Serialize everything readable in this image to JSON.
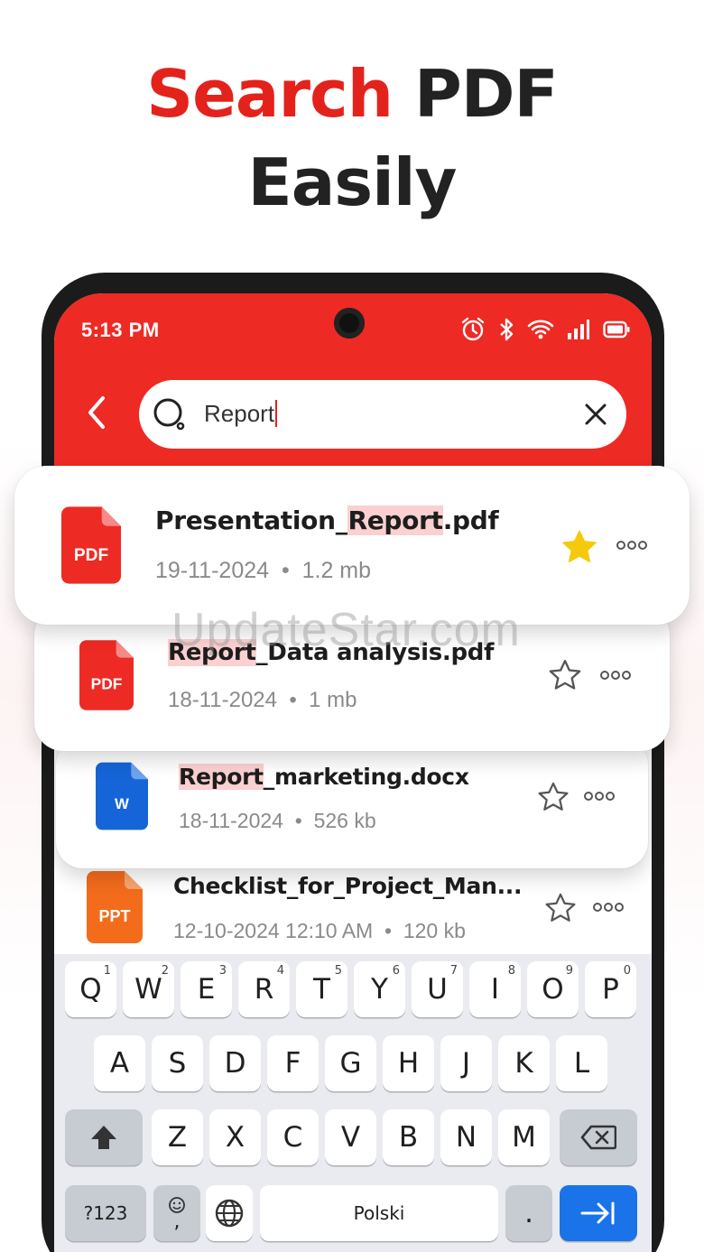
{
  "headline": {
    "line1_accent": "Search",
    "line1_rest": " PDF",
    "line2": "Easily"
  },
  "status_bar": {
    "time": "5:13 PM"
  },
  "search": {
    "query": "Report"
  },
  "files": [
    {
      "name_pre": "Presentation_",
      "name_hl": "Report",
      "name_post": ".pdf",
      "date": "19-11-2024",
      "size": "1.2 mb",
      "type_label": "PDF",
      "starred": true
    },
    {
      "name_pre": "",
      "name_hl": "Report",
      "name_post": "_Data analysis.pdf",
      "date": "18-11-2024",
      "size": "1 mb",
      "type_label": "PDF",
      "starred": false
    },
    {
      "name_pre": "",
      "name_hl": "Report",
      "name_post": "_marketing.docx",
      "date": "18-11-2024",
      "size": "526 kb",
      "type_label": "W",
      "starred": false
    },
    {
      "name_pre": "Checklist_for_Project_Man...",
      "name_hl": "",
      "name_post": "",
      "date": "12-10-2024 12:10 AM",
      "size": "120 kb",
      "type_label": "PPT",
      "starred": false
    }
  ],
  "meta_separator": "•",
  "keyboard": {
    "row1": [
      "Q",
      "W",
      "E",
      "R",
      "T",
      "Y",
      "U",
      "I",
      "O",
      "P"
    ],
    "row1_sup": [
      "1",
      "2",
      "3",
      "4",
      "5",
      "6",
      "7",
      "8",
      "9",
      "0"
    ],
    "row2": [
      "A",
      "S",
      "D",
      "F",
      "G",
      "H",
      "J",
      "K",
      "L"
    ],
    "row3": [
      "Z",
      "X",
      "C",
      "V",
      "B",
      "N",
      "M"
    ],
    "symbols_label": "?123",
    "comma_label": ",",
    "space_label": "Polski",
    "period_label": "."
  },
  "watermark": "UpdateStar.com",
  "colors": {
    "brand_red": "#ee2a24",
    "pdf_red": "#ee2a24",
    "word_blue": "#1565d8",
    "ppt_orange": "#f36c1c",
    "star_yellow": "#f6c90e",
    "enter_blue": "#1a73e8"
  },
  "icons": [
    "back-arrow-icon",
    "search-icon",
    "clear-icon",
    "pdf-file-icon",
    "word-file-icon",
    "ppt-file-icon",
    "star-icon",
    "more-icon",
    "shift-icon",
    "backspace-icon",
    "emoji-icon",
    "globe-icon",
    "enter-icon",
    "alarm-icon",
    "bluetooth-icon",
    "wifi-icon",
    "signal-icon",
    "battery-icon"
  ]
}
